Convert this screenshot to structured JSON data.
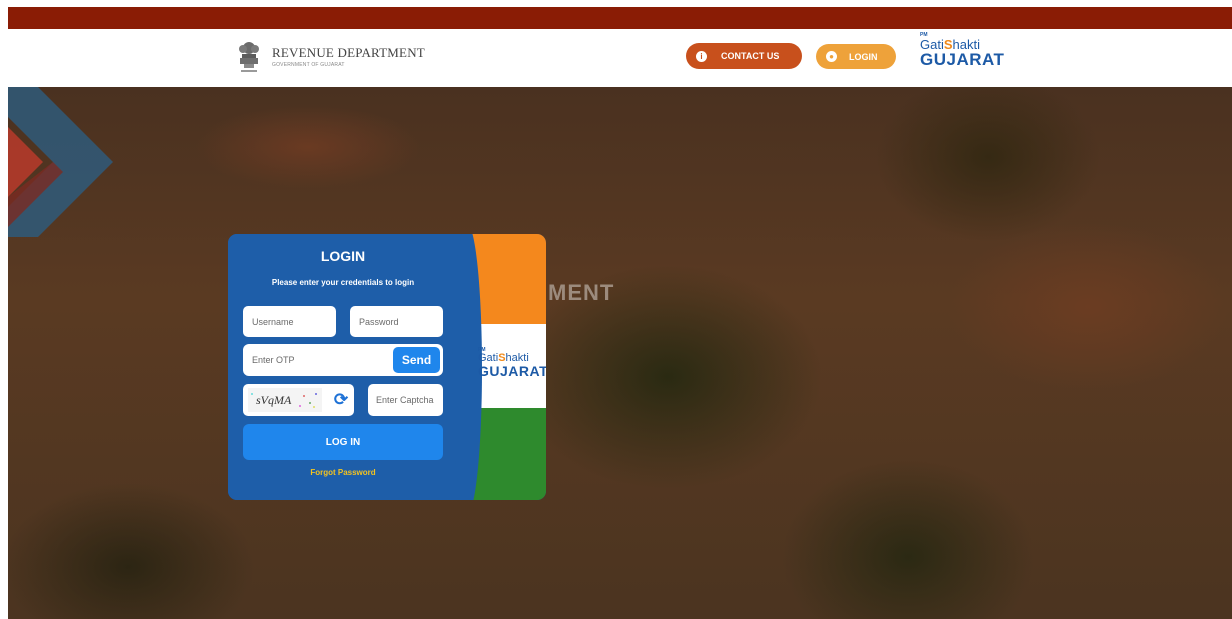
{
  "header": {
    "dept_title": "REVENUE DEPARTMENT",
    "dept_subtitle": "GOVERNMENT OF GUJARAT",
    "emblem_icon": "state-emblem-icon",
    "contact_label": "CONTACT US",
    "contact_icon": "info-icon",
    "login_label": "LOGIN",
    "login_icon": "user-icon",
    "brand": {
      "pm": "PM",
      "line1_a": "Gati",
      "line1_b": "S",
      "line1_c": "hakti",
      "line2": "GUJARAT"
    }
  },
  "hero": {
    "partial_text": "MENT"
  },
  "login_form": {
    "title": "LOGIN",
    "subtitle": "Please enter your credentials to login",
    "username_placeholder": "Username",
    "password_placeholder": "Password",
    "otp_placeholder": "Enter OTP",
    "send_label": "Send",
    "captcha_text": "sVqMA",
    "refresh_icon": "refresh-icon",
    "captcha_placeholder": "Enter Captcha",
    "submit_label": "LOG IN",
    "forgot_label": "Forgot Password"
  },
  "colors": {
    "topbar": "#8a1c05",
    "contact": "#c8501c",
    "login": "#eea23a",
    "card_blue": "#1e5ea9",
    "button_blue": "#1f86ec",
    "saffron": "#f4881d",
    "green": "#2e8a2d",
    "forgot": "#f3c320"
  }
}
